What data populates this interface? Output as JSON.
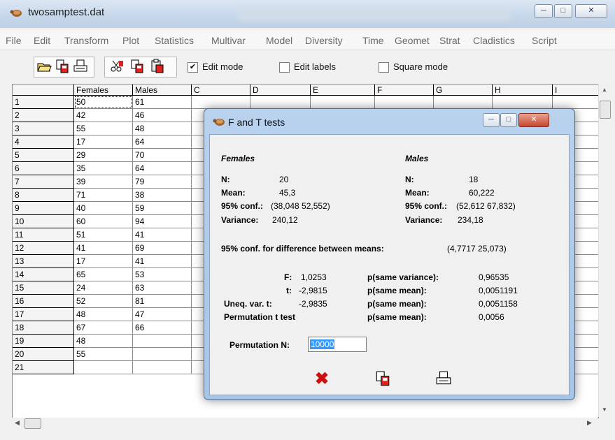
{
  "window": {
    "title": "twosamptest.dat"
  },
  "menu": [
    "File",
    "Edit",
    "Transform",
    "Plot",
    "Statistics",
    "Multivar",
    "Model",
    "Diversity",
    "Time",
    "Geomet",
    "Strat",
    "Cladistics",
    "Script"
  ],
  "toolbar": {
    "edit_mode": {
      "label": "Edit mode",
      "checked": true
    },
    "edit_labels": {
      "label": "Edit labels",
      "checked": false
    },
    "square_mode": {
      "label": "Square mode",
      "checked": false
    }
  },
  "grid": {
    "columns": [
      "Females",
      "Males",
      "C",
      "D",
      "E",
      "F",
      "G",
      "H",
      "I"
    ],
    "rows": [
      {
        "n": "1",
        "f": "50",
        "m": "61"
      },
      {
        "n": "2",
        "f": "42",
        "m": "46"
      },
      {
        "n": "3",
        "f": "55",
        "m": "48"
      },
      {
        "n": "4",
        "f": "17",
        "m": "64"
      },
      {
        "n": "5",
        "f": "29",
        "m": "70"
      },
      {
        "n": "6",
        "f": "35",
        "m": "64"
      },
      {
        "n": "7",
        "f": "39",
        "m": "79"
      },
      {
        "n": "8",
        "f": "71",
        "m": "38"
      },
      {
        "n": "9",
        "f": "40",
        "m": "59"
      },
      {
        "n": "10",
        "f": "60",
        "m": "94"
      },
      {
        "n": "11",
        "f": "51",
        "m": "41"
      },
      {
        "n": "12",
        "f": "41",
        "m": "69"
      },
      {
        "n": "13",
        "f": "17",
        "m": "41"
      },
      {
        "n": "14",
        "f": "65",
        "m": "53"
      },
      {
        "n": "15",
        "f": "24",
        "m": "63"
      },
      {
        "n": "16",
        "f": "52",
        "m": "81"
      },
      {
        "n": "17",
        "f": "48",
        "m": "47"
      },
      {
        "n": "18",
        "f": "67",
        "m": "66"
      },
      {
        "n": "19",
        "f": "48",
        "m": ""
      },
      {
        "n": "20",
        "f": "55",
        "m": ""
      },
      {
        "n": "21",
        "f": "",
        "m": ""
      }
    ]
  },
  "dialog": {
    "title": "F and T tests",
    "females": {
      "heading": "Females",
      "n_label": "N:",
      "n": "20",
      "mean_label": "Mean:",
      "mean": "45,3",
      "conf_label": "95% conf.:",
      "conf": "(38,048 52,552)",
      "var_label": "Variance:",
      "var": "240,12"
    },
    "males": {
      "heading": "Males",
      "n_label": "N:",
      "n": "18",
      "mean_label": "Mean:",
      "mean": "60,222",
      "conf_label": "95% conf.:",
      "conf": "(52,612 67,832)",
      "var_label": "Variance:",
      "var": "234,18"
    },
    "diff_label": "95% conf.  for difference between means:",
    "diff_value": "(4,7717 25,073)",
    "tests": [
      {
        "label": "F:",
        "value": "1,0253",
        "plabel": "p(same variance):",
        "p": "0,96535"
      },
      {
        "label": "t:",
        "value": "-2,9815",
        "plabel": "p(same mean):",
        "p": "0,0051191"
      },
      {
        "label": "Uneq. var. t:",
        "value": "-2,9835",
        "plabel": "p(same mean):",
        "p": "0,0051158"
      },
      {
        "label": "Permutation t test",
        "value": "",
        "plabel": "p(same mean):",
        "p": "0,0056"
      }
    ],
    "perm_label": "Permutation N:",
    "perm_value": "10000"
  }
}
